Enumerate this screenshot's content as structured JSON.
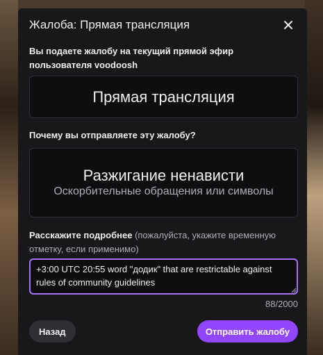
{
  "dialog": {
    "title": "Жалоба: Прямая трансляция",
    "intro": "Вы подаете жалобу на текущий прямой эфир пользователя voodoosh",
    "target": {
      "label": "Прямая трансляция"
    },
    "reason_question": "Почему вы отправляете эту жалобу?",
    "reason": {
      "title": "Разжигание ненависти",
      "description": "Оскорбительные обращения или символы"
    },
    "details": {
      "label_strong": "Расскажите подробнее",
      "label_hint": " (пожалуйста, укажите временную отметку, если применимо)",
      "value": "+3:00 UTC 20:55 word \"додик\" that are restrictable against rules of community guidelines",
      "counter": "88/2000"
    },
    "buttons": {
      "back": "Назад",
      "submit": "Отправить жалобу"
    }
  },
  "colors": {
    "accent": "#9147ff",
    "focus_border": "#a970ff",
    "modal_bg": "#18181b",
    "card_bg": "#0e0e10"
  },
  "icons": {
    "close": "close-icon"
  }
}
